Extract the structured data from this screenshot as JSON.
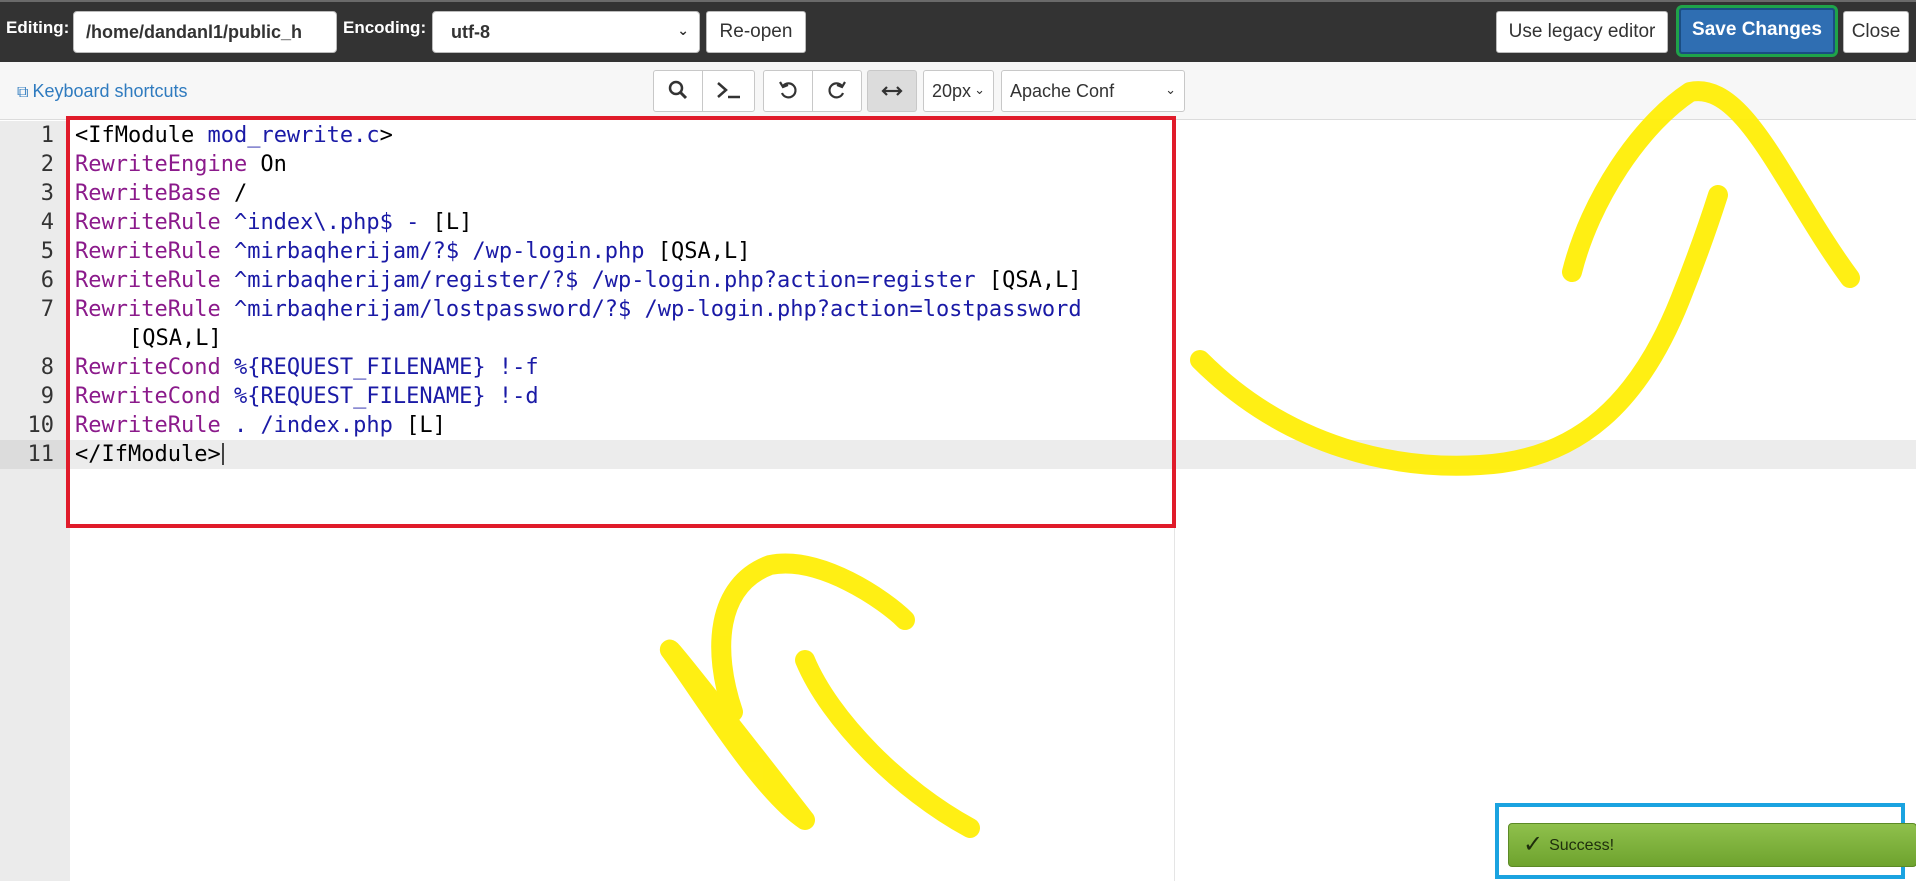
{
  "topbar": {
    "editing_label": "Editing:",
    "path_value": "/home/dandanl1/public_h",
    "encoding_label": "Encoding:",
    "encoding_value": "utf-8",
    "reopen_label": "Re-open",
    "legacy_label": "Use legacy editor",
    "save_label": "Save Changes",
    "close_label": "Close"
  },
  "toolbar": {
    "keyboard_shortcuts": "Keyboard shortcuts",
    "font_size": "20px",
    "mode": "Apache Conf"
  },
  "editor": {
    "lines": [
      {
        "n": "1",
        "kw": "<IfModule",
        "val": " mod_rewrite.c",
        "tail": ">"
      },
      {
        "n": "2",
        "kw": "RewriteEngine",
        "val": "",
        "tail": " On"
      },
      {
        "n": "3",
        "kw": "RewriteBase",
        "val": "",
        "tail": " /"
      },
      {
        "n": "4",
        "kw": "RewriteRule",
        "val": " ^index\\.php$ -",
        "tail": " [L]"
      },
      {
        "n": "5",
        "kw": "RewriteRule",
        "val": " ^mirbaqherijam/?$ /wp-login.php",
        "tail": " [QSA,L]"
      },
      {
        "n": "6",
        "kw": "RewriteRule",
        "val": " ^mirbaqherijam/register/?$ /wp-login.php?action=register",
        "tail": " [QSA,L]"
      },
      {
        "n": "7",
        "kw": "RewriteRule",
        "val": " ^mirbaqherijam/lostpassword/?$ /wp-login.php?action=lostpassword",
        "tail": "",
        "continuation": "[QSA,L]"
      },
      {
        "n": "8",
        "kw": "RewriteCond",
        "val": " %{REQUEST_FILENAME} !-f",
        "tail": ""
      },
      {
        "n": "9",
        "kw": "RewriteCond",
        "val": " %{REQUEST_FILENAME} !-d",
        "tail": ""
      },
      {
        "n": "10",
        "kw": "RewriteRule",
        "val": " . /index.php",
        "tail": " [L]"
      },
      {
        "n": "11",
        "kw": "",
        "val": "",
        "tail": "</IfModule>"
      }
    ]
  },
  "toast": {
    "text": "Success!"
  },
  "icons": {
    "search": "search-icon",
    "terminal": "terminal-icon",
    "undo": "undo-icon",
    "redo": "redo-icon",
    "wrap": "wrap-icon",
    "external": "external-link-icon",
    "check": "check-icon"
  },
  "colors": {
    "save_button": "#2f6eb2",
    "annotation_red": "#e01b2a",
    "annotation_blue": "#1aa3e0",
    "annotation_green": "#1fa34a",
    "highlighter_yellow": "#ffee00",
    "toast_green": "#7fb23c",
    "keyword": "#8b1a8b",
    "value": "#1a1aa6"
  }
}
